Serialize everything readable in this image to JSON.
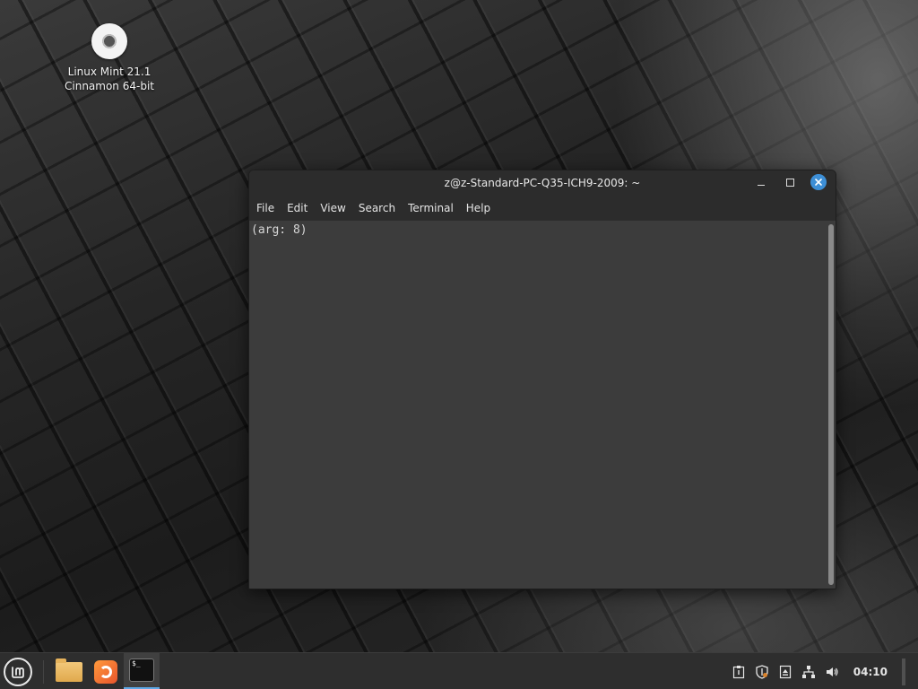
{
  "desktop": {
    "icon_label_line1": "Linux Mint 21.1",
    "icon_label_line2": "Cinnamon 64-bit"
  },
  "terminal": {
    "title": "z@z-Standard-PC-Q35-ICH9-2009: ~",
    "menu": [
      "File",
      "Edit",
      "View",
      "Search",
      "Terminal",
      "Help"
    ],
    "content": "(arg: 8)"
  },
  "taskbar": {
    "clock": "04:10",
    "launchers": [
      "files-icon",
      "firefox-icon",
      "terminal-icon"
    ],
    "tray_icons": [
      "clipboard-icon",
      "shield-icon",
      "update-icon",
      "network-icon",
      "volume-icon"
    ]
  },
  "colors": {
    "close_button": "#3d8fd6",
    "active_indicator": "#5ea8e6"
  }
}
